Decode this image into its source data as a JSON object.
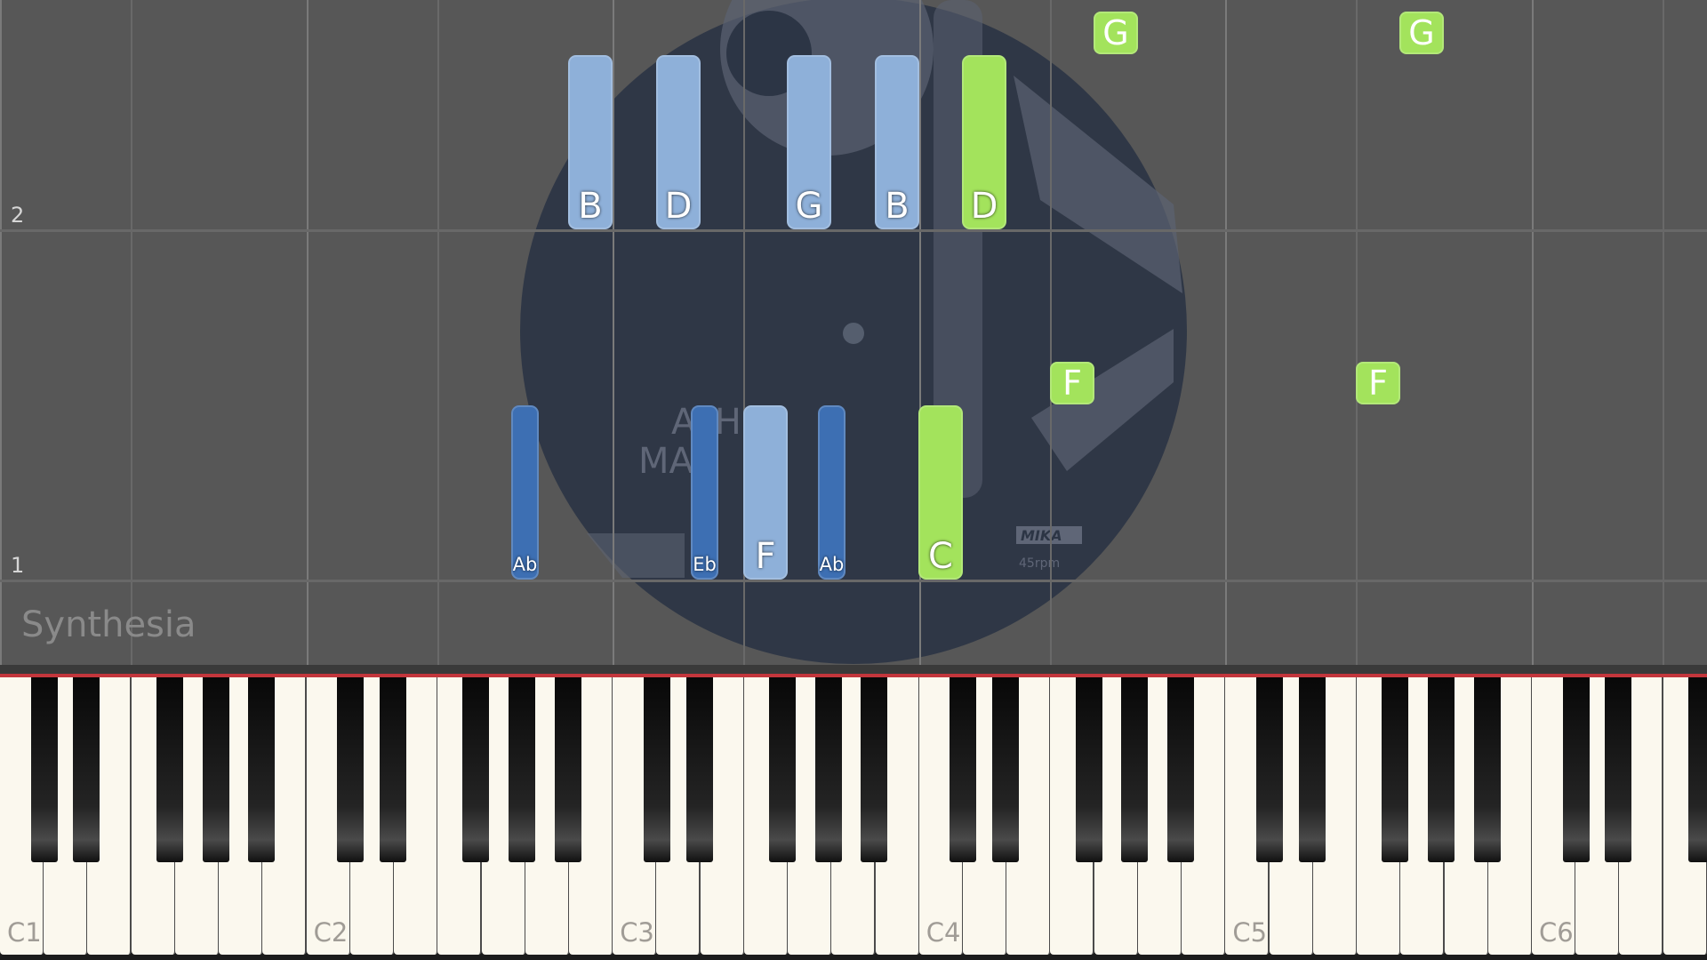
{
  "watermark": "Synthesia",
  "measures": {
    "upper": "2",
    "lower": "1"
  },
  "album_art": {
    "line1": "ATH",
    "line2": "MAH",
    "logo": "MIKA",
    "rpm": "45rpm"
  },
  "colors": {
    "right_hand_light": "#8eb0d9",
    "left_hand_dark": "#3d6fb3",
    "active_green": "#a3e35c",
    "hit_line": "#c3363c"
  },
  "notes_upper": [
    {
      "label": "B",
      "color": "light"
    },
    {
      "label": "D",
      "color": "light"
    },
    {
      "label": "G",
      "color": "light"
    },
    {
      "label": "B",
      "color": "light"
    },
    {
      "label": "D",
      "color": "green"
    },
    {
      "label": "G",
      "color": "green"
    },
    {
      "label": "G",
      "color": "green"
    }
  ],
  "notes_lower": [
    {
      "label": "Ab",
      "color": "dark"
    },
    {
      "label": "Eb",
      "color": "dark"
    },
    {
      "label": "F",
      "color": "light"
    },
    {
      "label": "Ab",
      "color": "dark"
    },
    {
      "label": "C",
      "color": "green"
    },
    {
      "label": "F",
      "color": "green"
    },
    {
      "label": "F",
      "color": "green"
    }
  ],
  "octave_labels": [
    "C1",
    "C2",
    "C3",
    "C4",
    "C5",
    "C6"
  ]
}
